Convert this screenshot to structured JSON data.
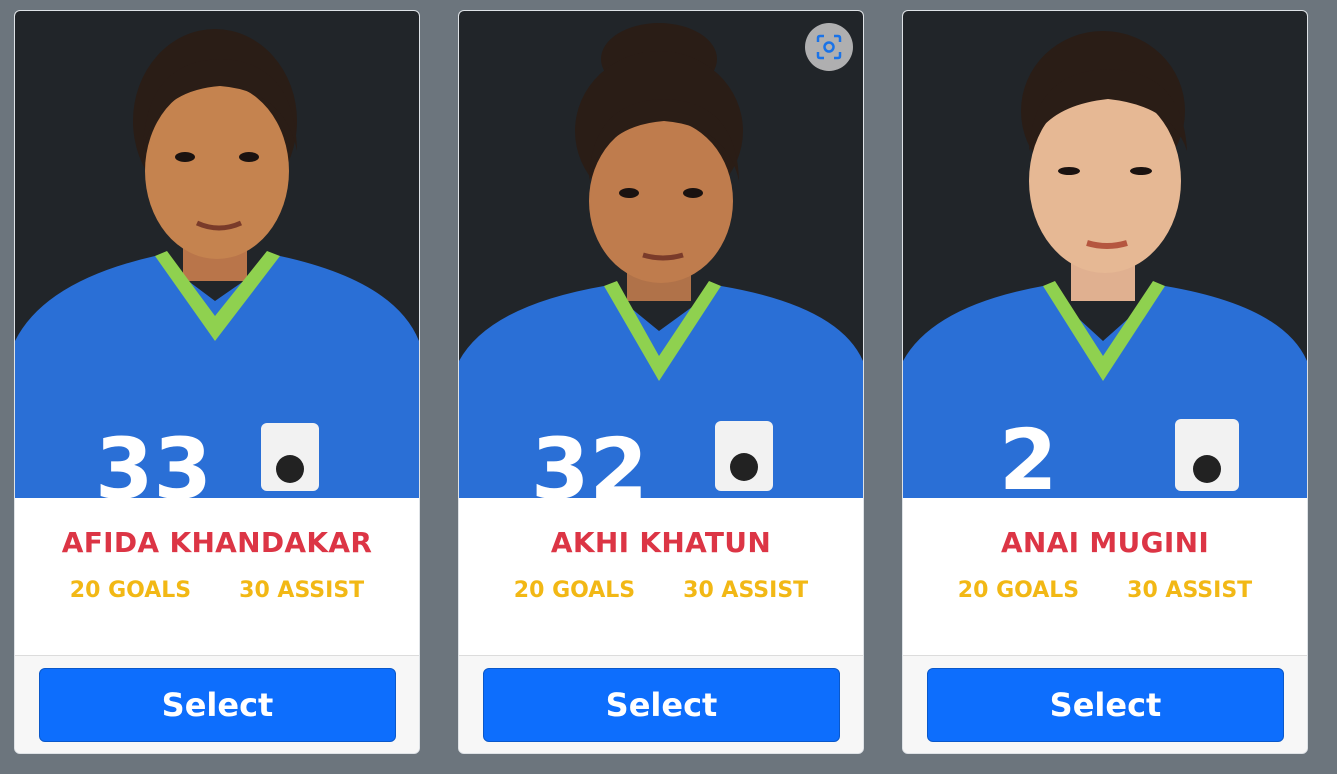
{
  "colors": {
    "page_bg": "#6c757d",
    "photo_bg": "#212529",
    "name": "#dc3545",
    "stats": "#f2b815",
    "button": "#0d6efd",
    "jersey": "#2a6fd6",
    "collar": "#8fd14f"
  },
  "players": [
    {
      "name": "AFIDA KHANDAKAR",
      "goals": "20 GOALS",
      "assist": "30 ASSIST",
      "jersey_number": "33",
      "select_label": "Select"
    },
    {
      "name": "AKHI KHATUN",
      "goals": "20 GOALS",
      "assist": "30 ASSIST",
      "jersey_number": "32",
      "select_label": "Select",
      "image_search_icon": "lens-icon"
    },
    {
      "name": "ANAI MUGINI",
      "goals": "20 GOALS",
      "assist": "30 ASSIST",
      "jersey_number": "2",
      "select_label": "Select"
    }
  ]
}
